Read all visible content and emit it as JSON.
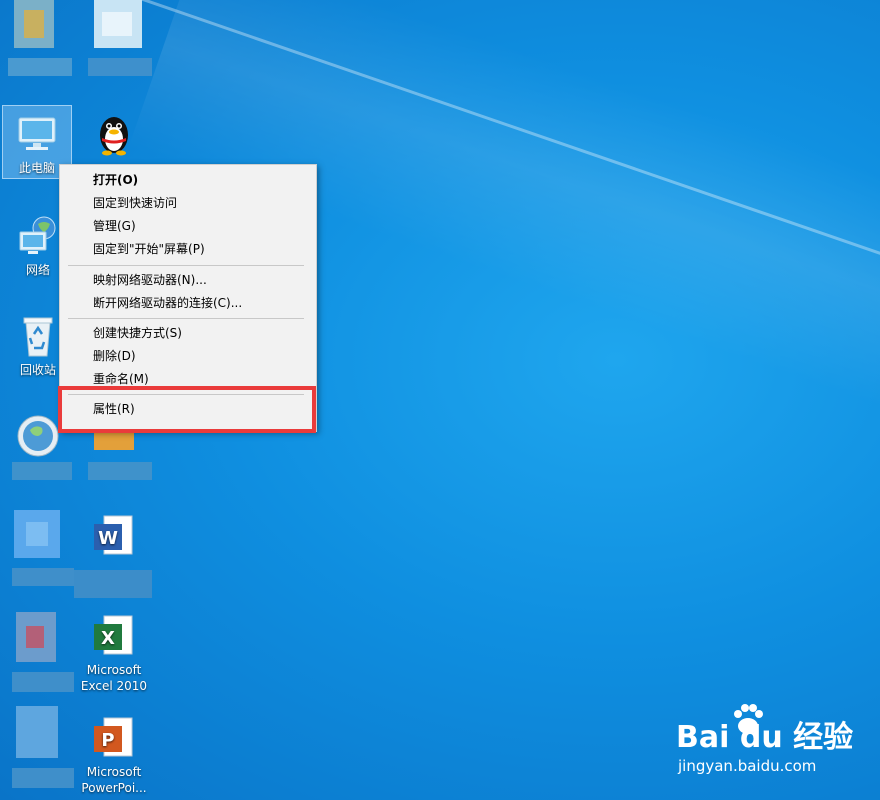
{
  "desktop": {
    "icons": {
      "this_pc": "此电脑",
      "qq": "腾讯QQ",
      "network": "网络",
      "recycle_bin": "回收站",
      "excel": "Microsoft Excel 2010",
      "ppt": "Microsoft PowerPoi..."
    }
  },
  "context_menu": {
    "open": "打开(O)",
    "pin_quick_access": "固定到快速访问",
    "manage": "管理(G)",
    "pin_start": "固定到\"开始\"屏幕(P)",
    "map_drive": "映射网络驱动器(N)...",
    "disconnect_drive": "断开网络驱动器的连接(C)...",
    "create_shortcut": "创建快捷方式(S)",
    "delete": "删除(D)",
    "rename": "重命名(M)",
    "properties": "属性(R)"
  },
  "watermark": {
    "brand": "Bai du 经验",
    "url": "jingyan.baidu.com"
  },
  "colors": {
    "desktop": "#0f8fe0",
    "menu_bg": "#f2f2f2",
    "highlight": "#ea3b3b"
  }
}
